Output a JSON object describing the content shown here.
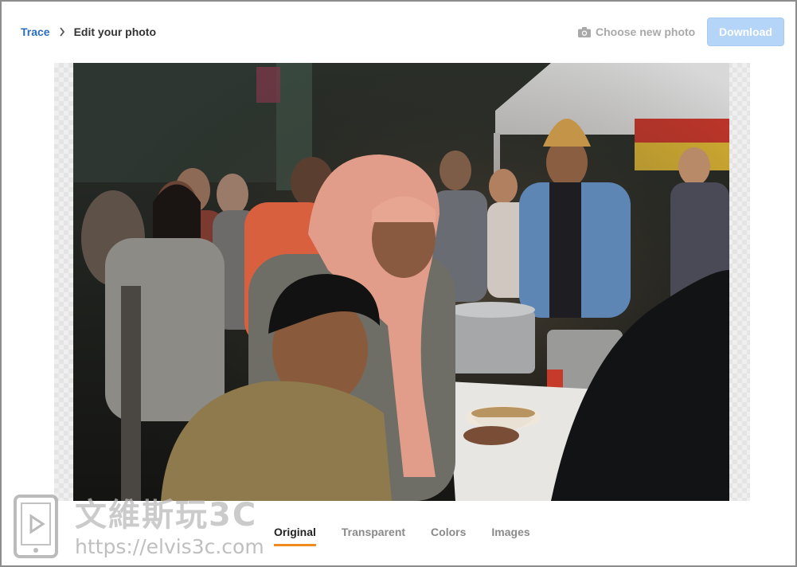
{
  "breadcrumb": {
    "root_label": "Trace",
    "current_label": "Edit your photo"
  },
  "header": {
    "choose_photo_label": "Choose new photo",
    "download_label": "Download"
  },
  "canvas": {
    "image_alt": "Crowd of people at a night food market; woman in pink hijab holding a bowl"
  },
  "tabs": [
    {
      "label": "Original",
      "active": true
    },
    {
      "label": "Transparent",
      "active": false
    },
    {
      "label": "Colors",
      "active": false
    },
    {
      "label": "Images",
      "active": false
    }
  ],
  "watermark": {
    "title": "文維斯玩3C",
    "url": "https://elvis3c.com"
  },
  "colors": {
    "link": "#2a6ebb",
    "download_bg": "#b4d5f7",
    "active_tab_underline": "#f08c1f",
    "muted_text": "#a9a9a9"
  },
  "icons": {
    "separator": "chevron-right-icon",
    "choose_photo": "camera-icon"
  }
}
